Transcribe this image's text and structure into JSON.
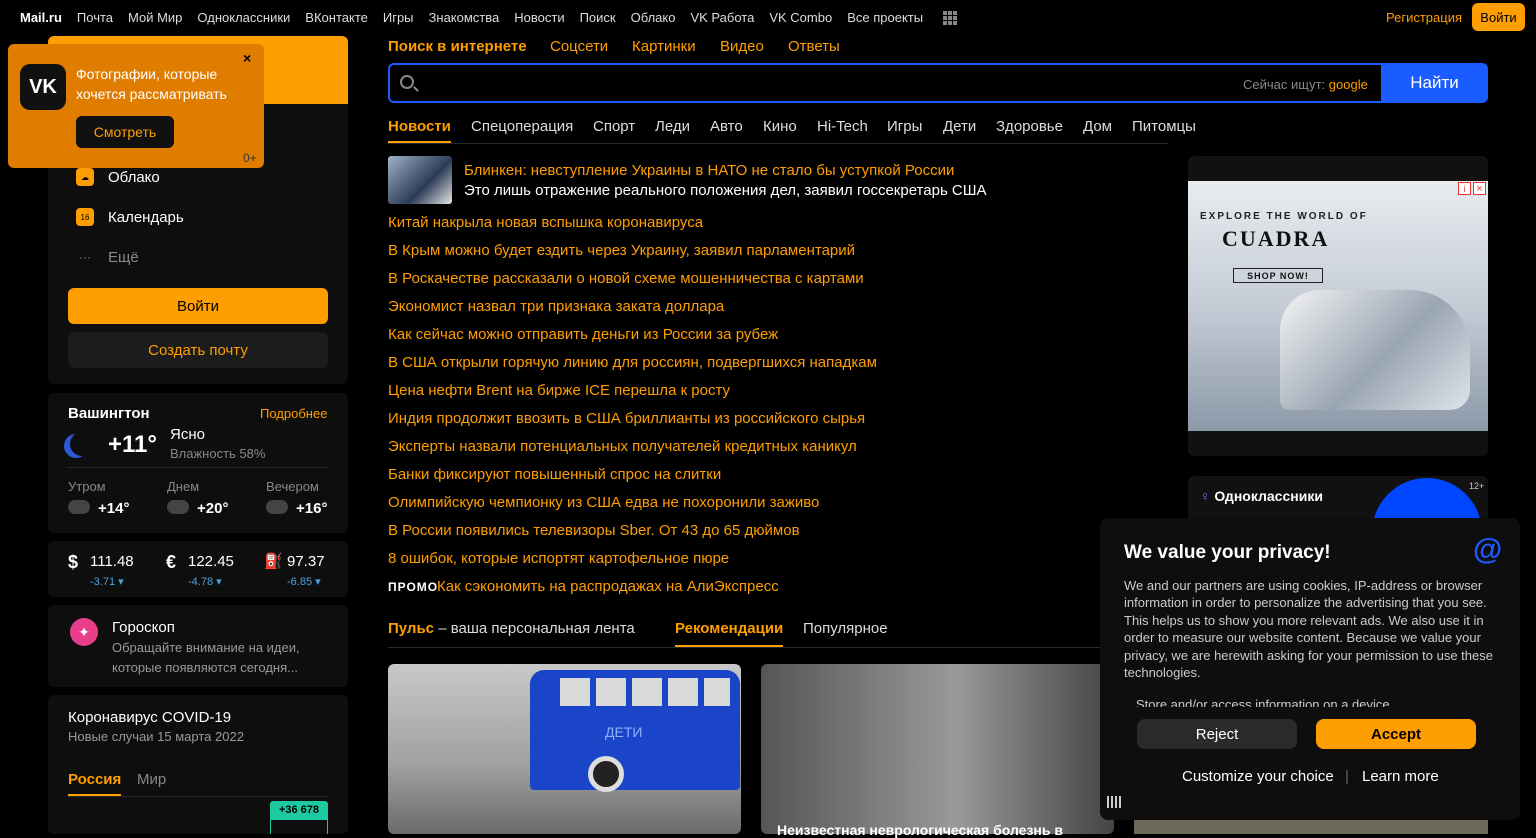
{
  "topnav": {
    "items": [
      "Mail.ru",
      "Почта",
      "Мой Мир",
      "Одноклассники",
      "ВКонтакте",
      "Игры",
      "Знакомства",
      "Новости",
      "Поиск",
      "Облако",
      "VK Работа",
      "VK Combo",
      "Все проекты"
    ],
    "register": "Регистрация",
    "login": "Войти"
  },
  "vk_popup": {
    "logo": "VK",
    "text": "Фотографии, которые хочется рассматривать",
    "button": "Смотреть",
    "close": "×",
    "age": "0+"
  },
  "sidebar": {
    "items": [
      {
        "label": "Облако",
        "icon": "cloud-icon"
      },
      {
        "label": "Календарь",
        "icon": "calendar-icon"
      },
      {
        "label": "Ещё",
        "icon": "more-icon"
      }
    ],
    "login": "Войти",
    "create_mail": "Создать почту"
  },
  "weather": {
    "city": "Вашингтон",
    "more": "Подробнее",
    "temp": "+11°",
    "desc": "Ясно",
    "humidity": "Влажность 58%",
    "parts": [
      {
        "label": "Утром",
        "temp": "+14°"
      },
      {
        "label": "Днем",
        "temp": "+20°"
      },
      {
        "label": "Вечером",
        "temp": "+16°"
      }
    ]
  },
  "currency": [
    {
      "symbol": "$",
      "value": "111.48",
      "diff": "-3.71 ▾"
    },
    {
      "symbol": "€",
      "value": "122.45",
      "diff": "-4.78 ▾"
    },
    {
      "symbol": "⛽",
      "value": "97.37",
      "diff": "-6.85 ▾"
    }
  ],
  "horoscope": {
    "title": "Гороскоп",
    "text": "Обращайте внимание на идеи, которые появляются сегодня..."
  },
  "covid": {
    "title": "Коронавирус COVID-19",
    "subtitle": "Новые случаи 15 марта 2022",
    "tab_russia": "Россия",
    "tab_world": "Мир",
    "badge": "+36 678"
  },
  "search": {
    "tabs": [
      "Поиск в интернете",
      "Соцсети",
      "Картинки",
      "Видео",
      "Ответы"
    ],
    "hint_prefix": "Сейчас ищут:",
    "hint_value": "google",
    "button": "Найти"
  },
  "news": {
    "tabs": [
      "Новости",
      "Спецоперация",
      "Спорт",
      "Леди",
      "Авто",
      "Кино",
      "Hi-Tech",
      "Игры",
      "Дети",
      "Здоровье",
      "Дом",
      "Питомцы"
    ],
    "lead_title": "Блинкен: невступление Украины в НАТО не стало бы уступкой России",
    "lead_sub": "Это лишь отражение реального положения дел, заявил госсекретарь США",
    "items": [
      "Китай накрыла новая вспышка коронавируса",
      "В Крым можно будет ездить через Украину, заявил парламентарий",
      "В Роскачестве рассказали о новой схеме мошенничества с картами",
      "Экономист назвал три признака заката доллара",
      "Как сейчас можно отправить деньги из России за рубеж",
      "В США открыли горячую линию для россиян, подвергшихся нападкам",
      "Цена нефти Brent на бирже ICE перешла к росту",
      "Индия продолжит ввозить в США бриллианты из российского сырья",
      "Эксперты назвали потенциальных получателей кредитных каникул",
      "Банки фиксируют повышенный спрос на слитки",
      "Олимпийскую чемпионку из США едва не похоронили заживо",
      "В России появились телевизоры Sber. От 43 до 65 дюймов",
      "8 ошибок, которые испортят картофельное пюре"
    ],
    "promo_label": "ПРОМО",
    "promo_text": "Как сэкономить на распродажах на АлиЭкспресс"
  },
  "puls": {
    "title": "Пульс",
    "title_rest": " – ваша персональная лента",
    "tab_rec": "Рекомендации",
    "tab_pop": "Популярное",
    "card1_text": "ДЕТИ",
    "card2_title": "Неизвестная неврологическая болезнь в"
  },
  "ad": {
    "explore": "EXPLORE THE WORLD OF",
    "brand": "CUADRA",
    "shop": "SHOP NOW!"
  },
  "ok": {
    "title": "Одноклассники",
    "age": "12+"
  },
  "privacy": {
    "title": "We value your privacy!",
    "text": "We and our partners are using cookies, IP-address or browser information in order to personalize the advertising that you see. This helps us to show you more relevant ads. We also use it in order to measure our website content. Because we value your privacy, we are herewith asking for your permission to use these technologies.",
    "store": "Store and/or access information on a device",
    "reject": "Reject",
    "accept": "Accept",
    "customize": "Customize your choice",
    "separator": "|",
    "learn": "Learn more",
    "logo": "@"
  },
  "colors": {
    "accent": "#ff9e00",
    "blue": "#1a5cff",
    "background": "#000000"
  }
}
